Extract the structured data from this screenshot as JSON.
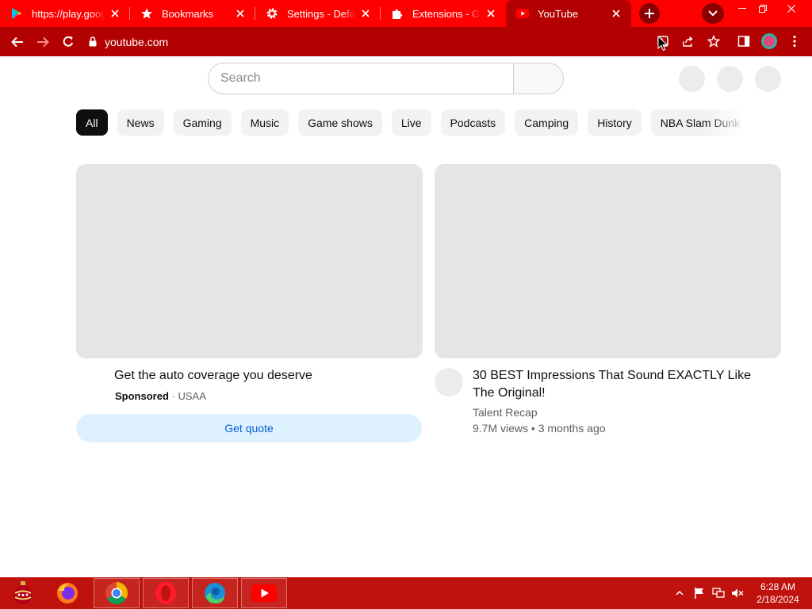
{
  "browser": {
    "tabs": [
      {
        "title": "https://play.google.com",
        "icon": "google-play-icon"
      },
      {
        "title": "Bookmarks",
        "icon": "star-icon"
      },
      {
        "title": "Settings - Default",
        "icon": "gear-icon"
      },
      {
        "title": "Extensions - Google Chrome",
        "icon": "puzzle-icon"
      },
      {
        "title": "YouTube",
        "icon": "youtube-icon",
        "active": true
      }
    ],
    "address": "youtube.com",
    "accent_color": "#ff0000",
    "toolbar_color": "#b30000"
  },
  "youtube": {
    "search_placeholder": "Search",
    "chips": [
      "All",
      "News",
      "Gaming",
      "Music",
      "Game shows",
      "Live",
      "Podcasts",
      "Camping",
      "History",
      "NBA Slam Dunk"
    ],
    "ad": {
      "title": "Get the auto coverage you deserve",
      "sponsored_label": "Sponsored",
      "separator": " · ",
      "advertiser": "USAA",
      "cta_label": "Get quote"
    },
    "video": {
      "title": "30 BEST Impressions That Sound EXACTLY Like The Original!",
      "channel": "Talent Recap",
      "stats": "9.7M views • 3 months ago"
    }
  },
  "taskbar": {
    "apps": [
      "ornament-icon",
      "firefox-icon",
      "chrome-icon",
      "opera-icon",
      "edge-icon",
      "youtube-icon"
    ],
    "time": "6:28 AM",
    "date": "2/18/2024"
  }
}
